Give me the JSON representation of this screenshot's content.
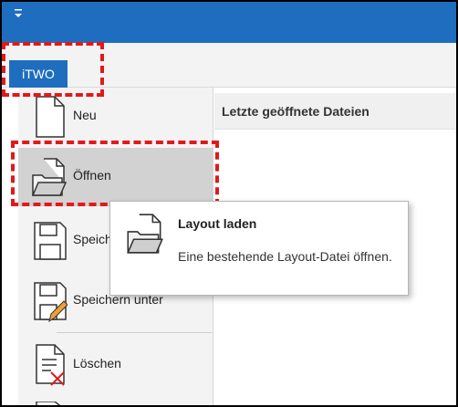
{
  "app": {
    "tab_label": "iTWO"
  },
  "backstage": {
    "items": [
      {
        "label": "Neu",
        "icon": "new-document-icon"
      },
      {
        "label": "Öffnen",
        "icon": "open-folder-icon"
      },
      {
        "label": "Speichern",
        "icon": "save-icon"
      },
      {
        "label": "Speichern unter",
        "icon": "save-as-icon"
      },
      {
        "label": "Löschen",
        "icon": "delete-document-icon"
      }
    ],
    "recent_files_title": "Letzte geöffnete Dateien"
  },
  "tooltip": {
    "title": "Layout laden",
    "description": "Eine bestehende Layout-Datei öffnen.",
    "icon": "open-folder-icon"
  },
  "colors": {
    "accent": "#1f6dbf",
    "highlight_dash": "#e0191b",
    "active_item": "#d2d2d2"
  }
}
